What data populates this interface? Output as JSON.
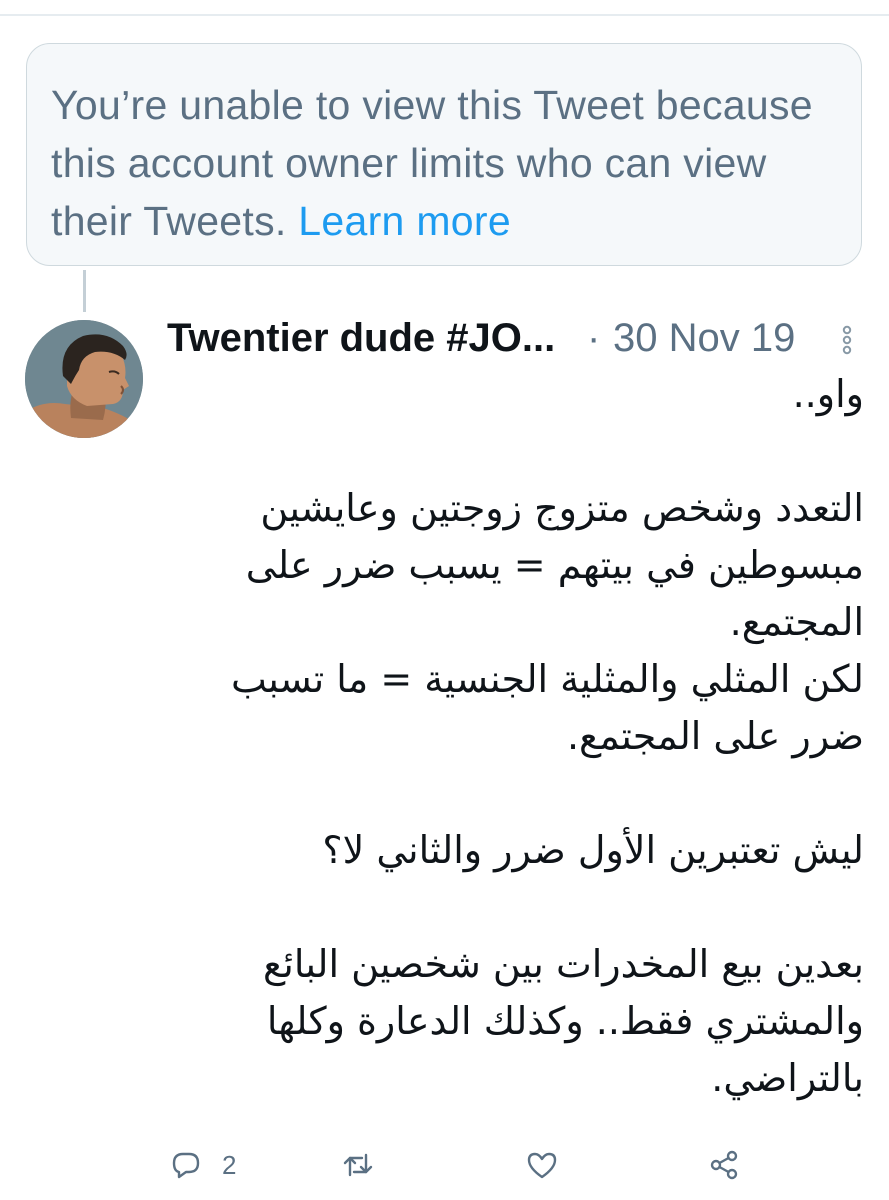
{
  "notice": {
    "text": "You’re unable to view this Tweet because this account owner limits who can view their Tweets.",
    "link": "Learn more"
  },
  "tweet": {
    "author": "Twentier dude #JO...",
    "separator": "·",
    "date": "30 Nov 19",
    "body": "واو..\n\nالتعدد وشخص متزوج زوجتين وعايشين مبسوطين في بيتهم = يسبب ضرر على المجتمع.\nلكن المثلي والمثلية الجنسية = ما تسبب ضرر على المجتمع.\n\nليش تعتبرين الأول ضرر والثاني لا؟\n\nبعدين بيع المخدرات بين شخصين البائع والمشتري فقط.. وكذلك الدعارة وكلها بالتراضي.",
    "reply_count": "2"
  },
  "icons": {
    "more": "more-vertical-icon",
    "reply": "reply-icon",
    "retweet": "retweet-icon",
    "like": "heart-icon",
    "share": "share-icon"
  },
  "colors": {
    "secondary_text": "#5b7083",
    "link": "#1d9bf0",
    "notice_background": "#f5f8fa",
    "border": "#cfd9de"
  }
}
